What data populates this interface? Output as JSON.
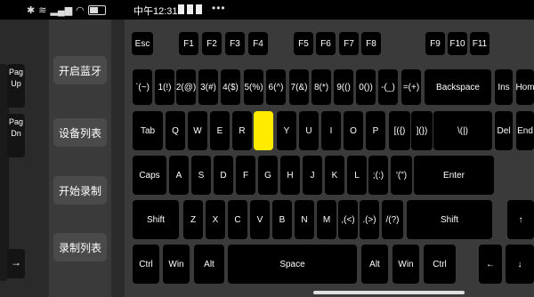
{
  "status": {
    "time": "中午12:31",
    "dots": "•••"
  },
  "side_keys": [
    "Pag Up",
    "Pag Dn",
    "→"
  ],
  "menu": [
    "开启蓝牙",
    "设备列表",
    "开始录制",
    "录制列表"
  ],
  "keyboard": {
    "highlighted_key": "U",
    "rows": {
      "function": [
        "Esc",
        "F1",
        "F2",
        "F3",
        "F4",
        "F5",
        "F6",
        "F7",
        "F8",
        "F9",
        "F10",
        "F11"
      ],
      "number": [
        "`(~)",
        "1(!)",
        "2(@)",
        "3(#)",
        "4($)",
        "5(%)",
        "6(^)",
        "7(&)",
        "8(*)",
        "9(()",
        "0())",
        "-(_)",
        "=(+)",
        "Backspace",
        "Ins",
        "Hom"
      ],
      "top": [
        "Tab",
        "Q",
        "W",
        "E",
        "R",
        "",
        "Y",
        "U",
        "I",
        "O",
        "P",
        "[({)",
        "](})",
        "\\(|)",
        "Del",
        "End"
      ],
      "home": [
        "Caps",
        "A",
        "S",
        "D",
        "F",
        "G",
        "H",
        "J",
        "K",
        "L",
        ";(:)",
        "'(\")",
        "Enter"
      ],
      "shift": [
        "Shift",
        "Z",
        "X",
        "C",
        "V",
        "B",
        "N",
        "M",
        ",(<)",
        ".(>)",
        "/(?)",
        "Shift",
        "↑"
      ],
      "bottom": [
        "Ctrl",
        "Win",
        "Alt",
        "Space",
        "Alt",
        "Win",
        "Ctrl",
        "←",
        "↓"
      ]
    }
  }
}
